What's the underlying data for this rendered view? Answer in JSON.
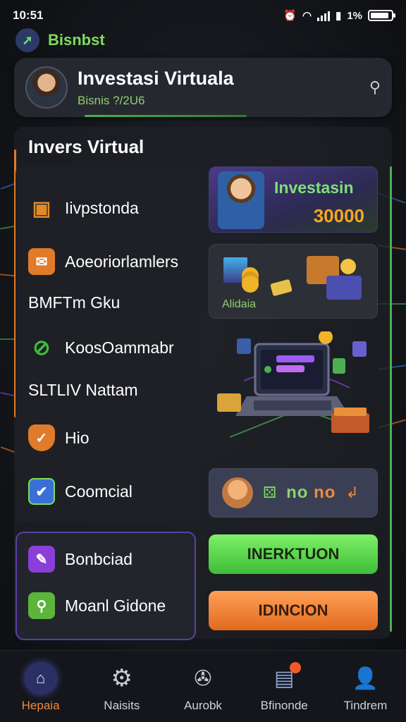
{
  "status_bar": {
    "time": "10:51",
    "battery": "1%",
    "battery_level": 0.9
  },
  "brand": {
    "name": "Bisnbst",
    "logo_icon": "arrow-logo-icon"
  },
  "profile": {
    "title": "Investasi Virtuala",
    "subtitle": "Bisnis ?/2U6"
  },
  "section": {
    "title": "Invers Virtual"
  },
  "menu": [
    {
      "label": "Iivpstonda",
      "icon": "boxes-icon",
      "color": "#e08a2a"
    },
    {
      "label": "Aoeoriorlamlers",
      "icon": "mail-icon",
      "color": "#e07b2a"
    },
    {
      "label": "BMFTm Gku",
      "icon": "",
      "color": ""
    },
    {
      "label": "KoosOammabr",
      "icon": "slash-icon",
      "color": "#3fbd39"
    },
    {
      "label": "SLTLIV Nattam",
      "icon": "",
      "color": ""
    },
    {
      "label": "Hio",
      "icon": "shield-icon",
      "color": "#e07b2a"
    },
    {
      "label": "Coomcial",
      "icon": "check-icon",
      "color": "#3a6fd8"
    }
  ],
  "bottom_menu": [
    {
      "label": "Bonbciad",
      "icon": "gift-icon",
      "color": "#8a3fd8"
    },
    {
      "label": "Moanl Gidone",
      "icon": "search-icon",
      "color": "#5bb53a"
    }
  ],
  "invest_card": {
    "label": "Investasin",
    "value": "30000"
  },
  "assets_card": {
    "label": "Alidaia"
  },
  "stats_card": {
    "value_green": "no",
    "value_orange": "no",
    "arrow": "↲"
  },
  "buttons": {
    "primary": "INERKTUON",
    "secondary": "IDINCION"
  },
  "nav": [
    {
      "label": "Hepaia",
      "icon": "home-icon",
      "active": true
    },
    {
      "label": "Naisits",
      "icon": "gear-icon",
      "active": false
    },
    {
      "label": "Aurobk",
      "icon": "compass-icon",
      "active": false
    },
    {
      "label": "Bfinonde",
      "icon": "document-icon",
      "active": false
    },
    {
      "label": "Tindrem",
      "icon": "user-icon",
      "active": false
    }
  ]
}
